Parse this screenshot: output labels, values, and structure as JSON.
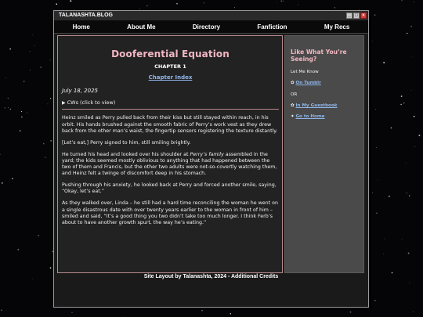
{
  "window": {
    "title": "TALANASHTA.BLOG"
  },
  "nav": [
    "Home",
    "About Me",
    "Directory",
    "Fanfiction",
    "My Recs"
  ],
  "story": {
    "title": "Dooferential Equation",
    "chapter": "CHAPTER 1",
    "chapter_index": "Chapter Index",
    "date": "July 18, 2025",
    "cws_label": "CWs (click to view)",
    "paragraphs": [
      {
        "text": "Heinz smiled as Perry pulled back from their kiss but still stayed within reach, in his orbit. His hands brushed against the smooth fabric of Perry’s work vest as they drew back from the other man’s waist, the fingertip sensors registering the texture distantly."
      },
      {
        "text": "[Let’s eat,] Perry signed to him, still smiling brightly."
      },
      {
        "before": "He turned his head and looked over his shoulder at ",
        "em": "Perry’s family",
        "after": " assembled in the yard; the kids seemed mostly oblivious to anything that had happened between the two of them and Francis, but the other two adults were not-so-covertly watching them, and Heinz felt a twinge of discomfort deep in his stomach."
      },
      {
        "text": "Pushing through his anxiety, he looked back at Perry and forced another smile, saying, “Okay, let’s eat.”"
      },
      {
        "text": "As they walked over, Linda – he still had a hard time reconciling the woman he went on a single disastrous date with over twenty years earlier to the woman in front of him – smiled and said, “It’s a good thing you two didn’t take too much longer. I think Ferb’s about to have another growth spurt, the way he’s eating.”"
      }
    ]
  },
  "sidebar": {
    "title": "Like What You’re Seeing?",
    "let_me_know": "Let Me Know",
    "tumblr_prefix": "✿",
    "tumblr_label": "On Tumblr",
    "or": "OR",
    "guestbook_prefix": "✿",
    "guestbook_label": "In My Guestbook",
    "home_prefix": "✦",
    "home_label": "Go to Home"
  },
  "footer": "Site Layout by Talanashta, 2024 - Additional Credits",
  "colors": {
    "accent_pink": "#f2b7c2",
    "link_blue": "#8fb6ea",
    "content_bg": "#222222",
    "sidebar_bg": "#4a4a4a"
  }
}
